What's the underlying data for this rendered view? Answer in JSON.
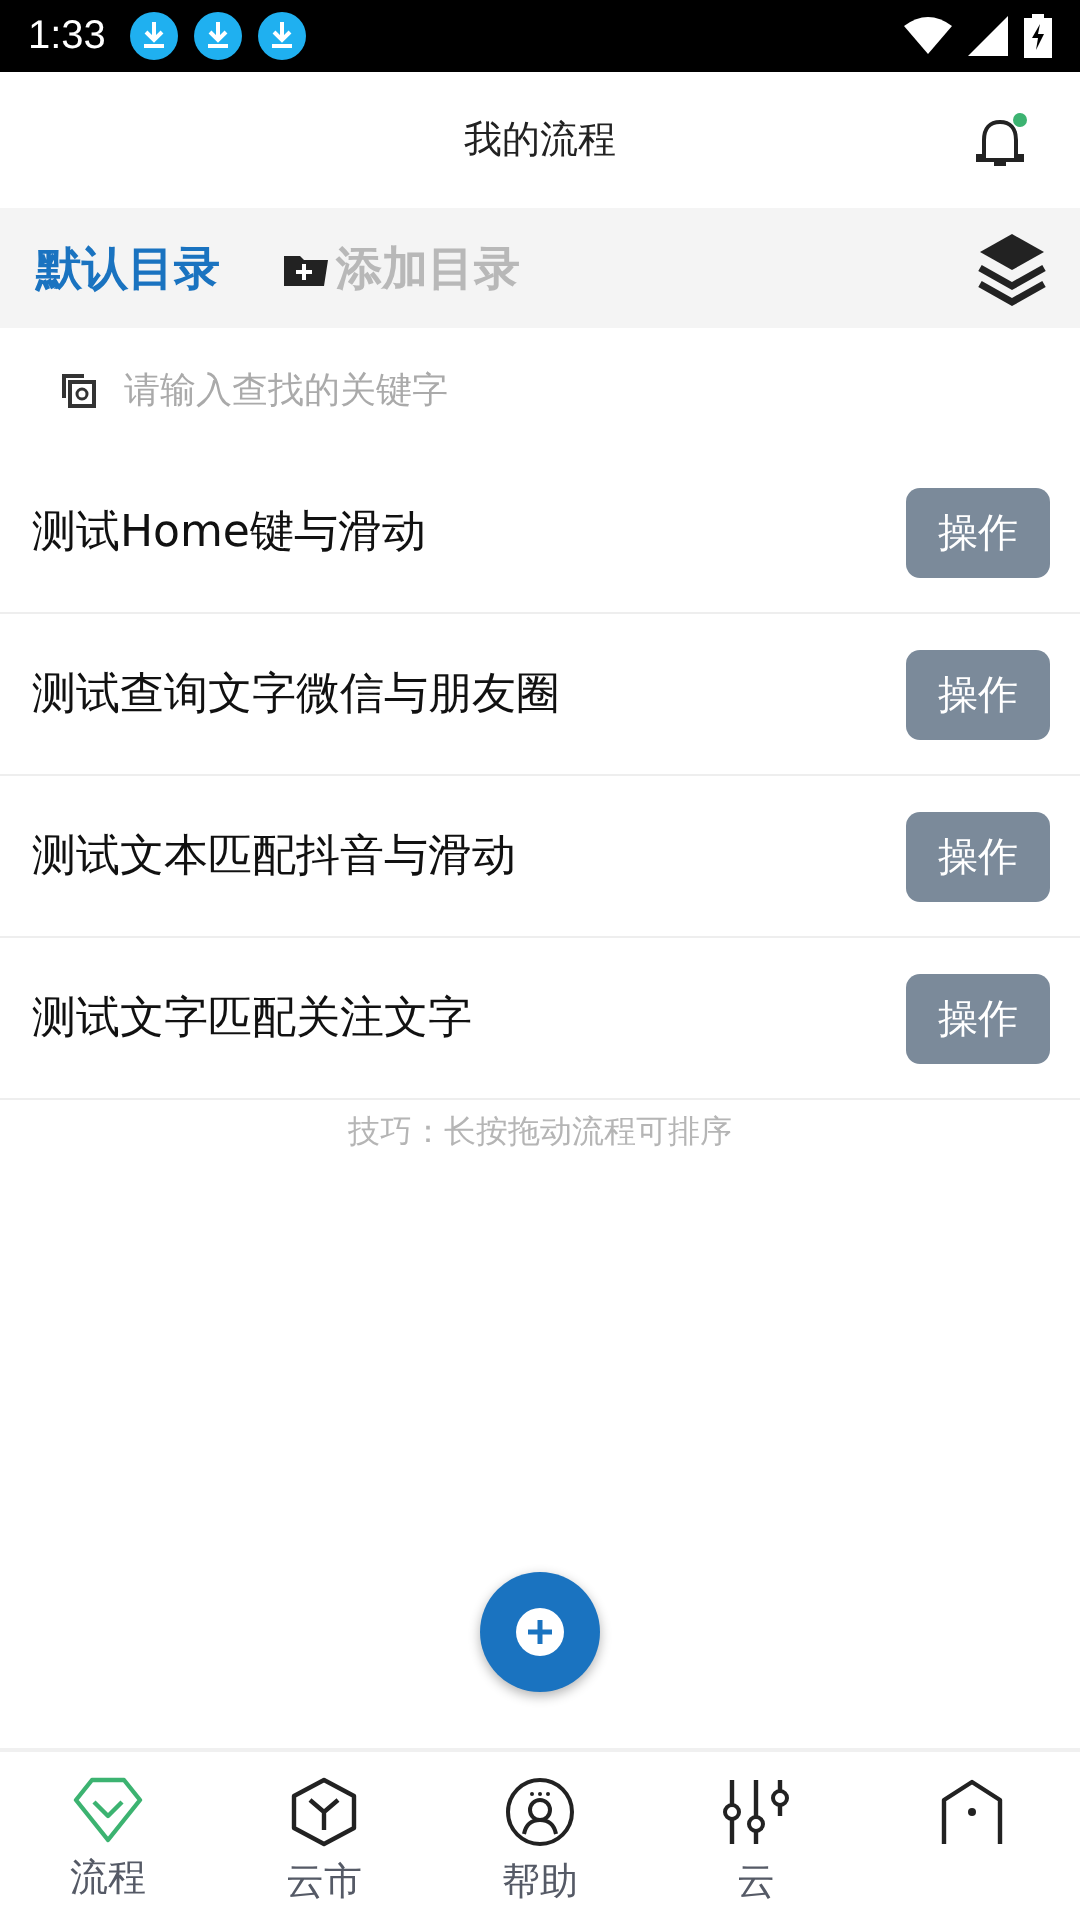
{
  "status_bar": {
    "time": "1:33"
  },
  "header": {
    "title": "我的流程",
    "notification_dot": true
  },
  "tabs": [
    {
      "label": "默认目录",
      "selected": true,
      "kind": "folder"
    },
    {
      "label": "添加目录",
      "selected": false,
      "kind": "add"
    }
  ],
  "search": {
    "placeholder": "请输入查找的关键字"
  },
  "flows": [
    {
      "name": "测试Home键与滑动",
      "action": "操作"
    },
    {
      "name": "测试查询文字微信与朋友圈",
      "action": "操作"
    },
    {
      "name": "测试文本匹配抖音与滑动",
      "action": "操作"
    },
    {
      "name": "测试文字匹配关注文字",
      "action": "操作"
    }
  ],
  "tip": "技巧：长按拖动流程可排序",
  "bottom_nav": [
    {
      "label": "流程",
      "selected": true,
      "kind": "flow"
    },
    {
      "label": "云市",
      "selected": false,
      "kind": "market"
    },
    {
      "label": "帮助",
      "selected": false,
      "kind": "help"
    },
    {
      "label": "云",
      "selected": false,
      "kind": "control"
    },
    {
      "selected": false,
      "kind": "home"
    }
  ]
}
